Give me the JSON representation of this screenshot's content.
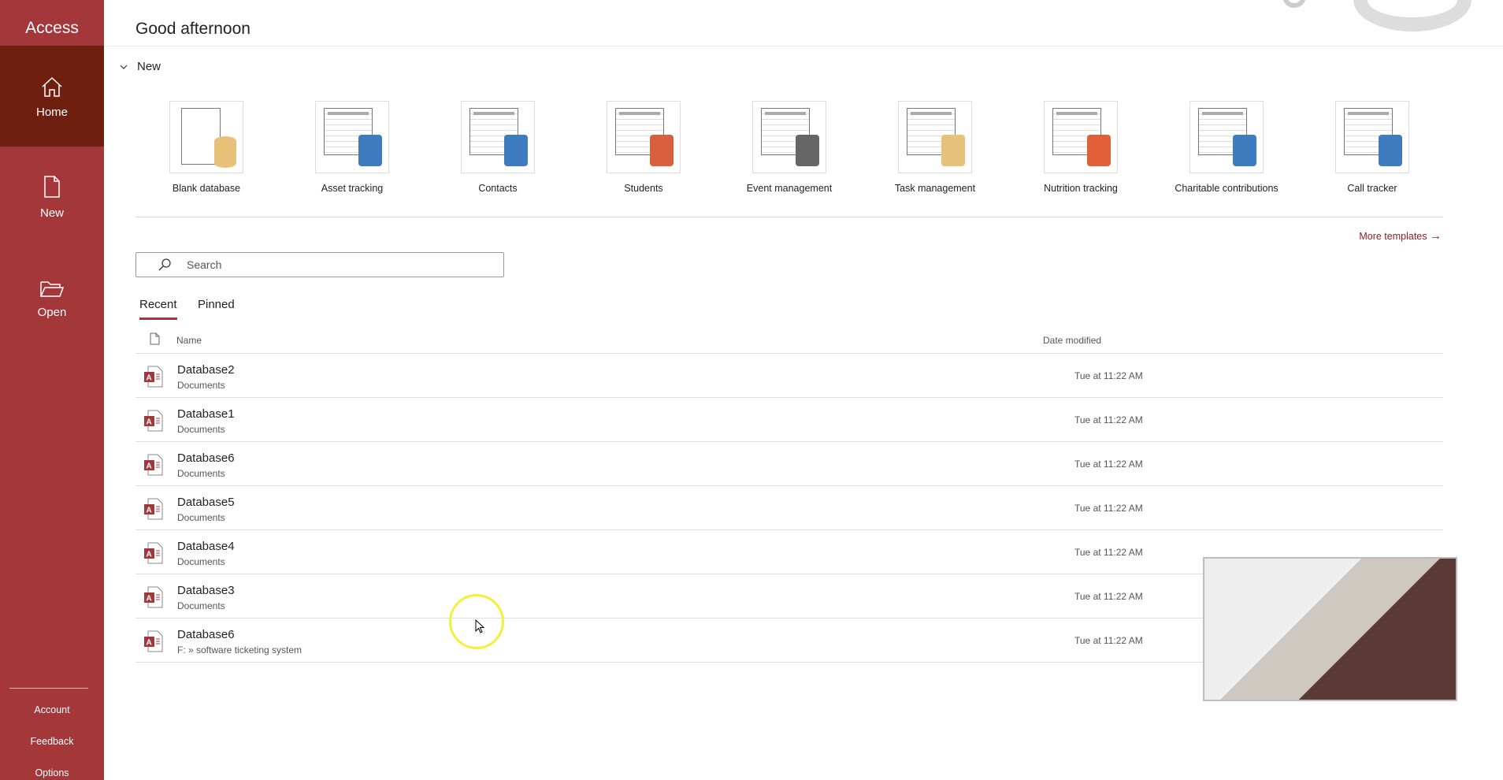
{
  "app_title": "Access",
  "sidebar": {
    "items": [
      {
        "label": "Home",
        "icon": "home-icon",
        "selected": true
      },
      {
        "label": "New",
        "icon": "new-file-icon"
      },
      {
        "label": "Open",
        "icon": "folder-open-icon"
      }
    ],
    "bottom": [
      "Account",
      "Feedback",
      "Options"
    ]
  },
  "greeting": "Good afternoon",
  "new_section": {
    "label": "New",
    "templates": [
      {
        "label": "Blank database",
        "accent": "#e8c27a"
      },
      {
        "label": "Asset tracking",
        "accent": "#3f7bbf"
      },
      {
        "label": "Contacts",
        "accent": "#3f7bbf"
      },
      {
        "label": "Students",
        "accent": "#d9603c"
      },
      {
        "label": "Event management",
        "accent": "#666666"
      },
      {
        "label": "Task management",
        "accent": "#e8c27a"
      },
      {
        "label": "Nutrition tracking",
        "accent": "#e0603a"
      },
      {
        "label": "Charitable contributions",
        "accent": "#3f7bbf"
      },
      {
        "label": "Call tracker",
        "accent": "#3f7bbf"
      }
    ],
    "more_templates": "More templates"
  },
  "search": {
    "placeholder": "Search"
  },
  "tabs": {
    "recent": "Recent",
    "pinned": "Pinned"
  },
  "columns": {
    "name": "Name",
    "date": "Date modified"
  },
  "files": [
    {
      "name": "Database2",
      "location": "Documents",
      "date": "Tue at 11:22 AM"
    },
    {
      "name": "Database1",
      "location": "Documents",
      "date": "Tue at 11:22 AM"
    },
    {
      "name": "Database6",
      "location": "Documents",
      "date": "Tue at 11:22 AM"
    },
    {
      "name": "Database5",
      "location": "Documents",
      "date": "Tue at 11:22 AM"
    },
    {
      "name": "Database4",
      "location": "Documents",
      "date": "Tue at 11:22 AM"
    },
    {
      "name": "Database3",
      "location": "Documents",
      "date": "Tue at 11:22 AM"
    },
    {
      "name": "Database6",
      "location": "F: » software ticketing system",
      "date": "Tue at 11:22 AM"
    }
  ],
  "colors": {
    "brand": "#a4373a",
    "selected": "#6f1f10"
  }
}
